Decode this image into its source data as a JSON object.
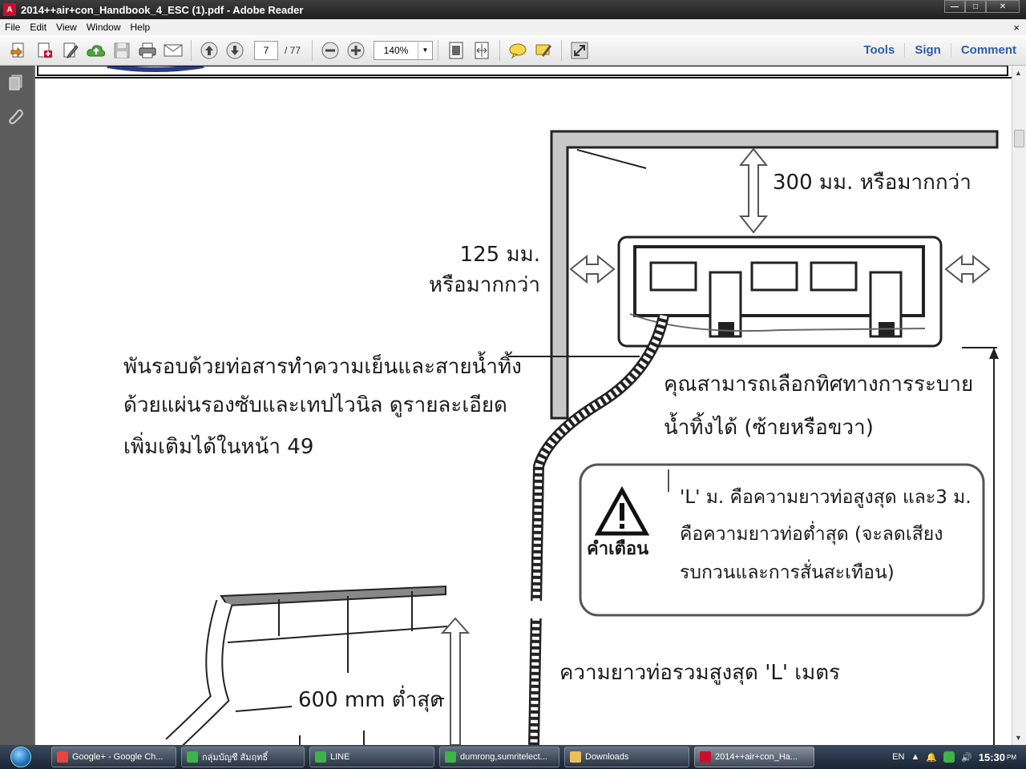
{
  "window": {
    "title": "2014++air+con_Handbook_4_ESC (1).pdf - Adobe Reader",
    "controls": {
      "minimize": "—",
      "maximize": "□",
      "close": "✕"
    }
  },
  "menu": {
    "items": [
      "File",
      "Edit",
      "View",
      "Window",
      "Help"
    ],
    "close_doc": "×"
  },
  "toolbar": {
    "page_current": "7",
    "page_total": "/ 77",
    "zoom": "140%",
    "zoom_dropdown": "▼",
    "tools_label": "Tools",
    "sign_label": "Sign",
    "comment_label": "Comment"
  },
  "document": {
    "label_clearance_top": "300 มม. หรือมากกว่า",
    "label_clearance_side_1": "125 มม.",
    "label_clearance_side_2": "หรือมากกว่า",
    "label_wrap_1": "พันรอบด้วยท่อสารทำความเย็นและสายน้ำทิ้ง",
    "label_wrap_2": "ด้วยแผ่นรองซับและเทปไวนิล ดูรายละเอียด",
    "label_wrap_3": "เพิ่มเติมได้ในหน้า 49",
    "label_drain_1": "คุณสามารถเลือกทิศทางการระบาย",
    "label_drain_2": "น้ำทิ้งได้ (ซ้ายหรือขวา)",
    "warning_title": "คำเตือน",
    "warning_line_1": "'L' ม. คือความยาวท่อสูงสุด และ3 ม.",
    "warning_line_2": "คือความยาวท่อต่ำสุด   (จะลดเสียง",
    "warning_line_3": "รบกวนและการสั่นสะเทือน)",
    "label_pipe_length": "ความยาวท่อรวมสูงสุด 'L' เมตร",
    "label_min_600": "600 mm ต่ำสุด"
  },
  "taskbar": {
    "tasks": [
      {
        "label": "Google+ - Google Ch...",
        "color": "#e8453c"
      },
      {
        "label": "กลุ่มบัญชี สัมฤทธิ์",
        "color": "#3fb24a"
      },
      {
        "label": "LINE",
        "color": "#3fb24a"
      },
      {
        "label": "dumrong,sumritelect...",
        "color": "#3fb24a"
      },
      {
        "label": "Downloads",
        "color": "#e8c15a"
      },
      {
        "label": "2014++air+con_Ha...",
        "color": "#c8102e"
      }
    ],
    "tray": {
      "lang": "EN",
      "time": "15:30",
      "ampm": "PM"
    }
  },
  "colors": {
    "accent_link": "#2b5da8",
    "title_bar": "#2a2a2a"
  }
}
